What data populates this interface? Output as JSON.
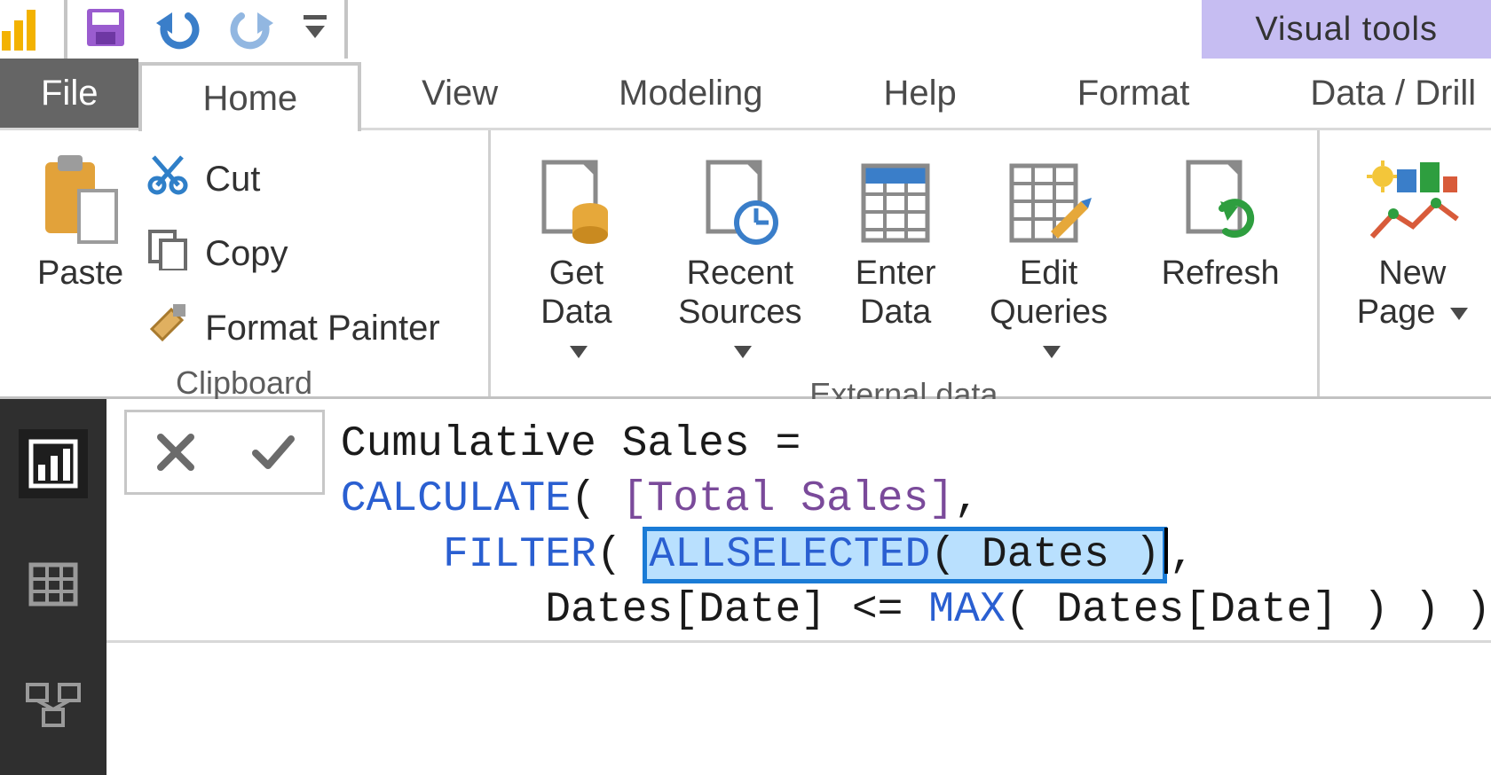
{
  "titlebar": {
    "context_tab": "Visual tools"
  },
  "tabs": {
    "file": "File",
    "home": "Home",
    "view": "View",
    "modeling": "Modeling",
    "help": "Help",
    "format": "Format",
    "datadrill": "Data / Drill"
  },
  "ribbon": {
    "clipboard": {
      "title": "Clipboard",
      "paste": "Paste",
      "cut": "Cut",
      "copy": "Copy",
      "format_painter": "Format Painter"
    },
    "externaldata": {
      "title": "External data",
      "get_data": "Get\nData",
      "recent_sources": "Recent\nSources",
      "enter_data": "Enter\nData",
      "edit_queries": "Edit\nQueries",
      "refresh": "Refresh"
    },
    "insert": {
      "new_page": "New\nPage"
    }
  },
  "formula": {
    "line1_a": "Cumulative Sales = ",
    "line2_calc": "CALCULATE",
    "line2_b": "( ",
    "line2_measure": "[Total Sales]",
    "line2_c": ",",
    "line3_pad": "    ",
    "line3_filter": "FILTER",
    "line3_a": "( ",
    "line3_allsel": "ALLSELECTED",
    "line3_allsel_arg": "( Dates )",
    "line3_b": ",",
    "line4_pad": "        ",
    "line4_a": "Dates[Date] <= ",
    "line4_max": "MAX",
    "line4_b": "( Dates[Date] ) ) )"
  }
}
